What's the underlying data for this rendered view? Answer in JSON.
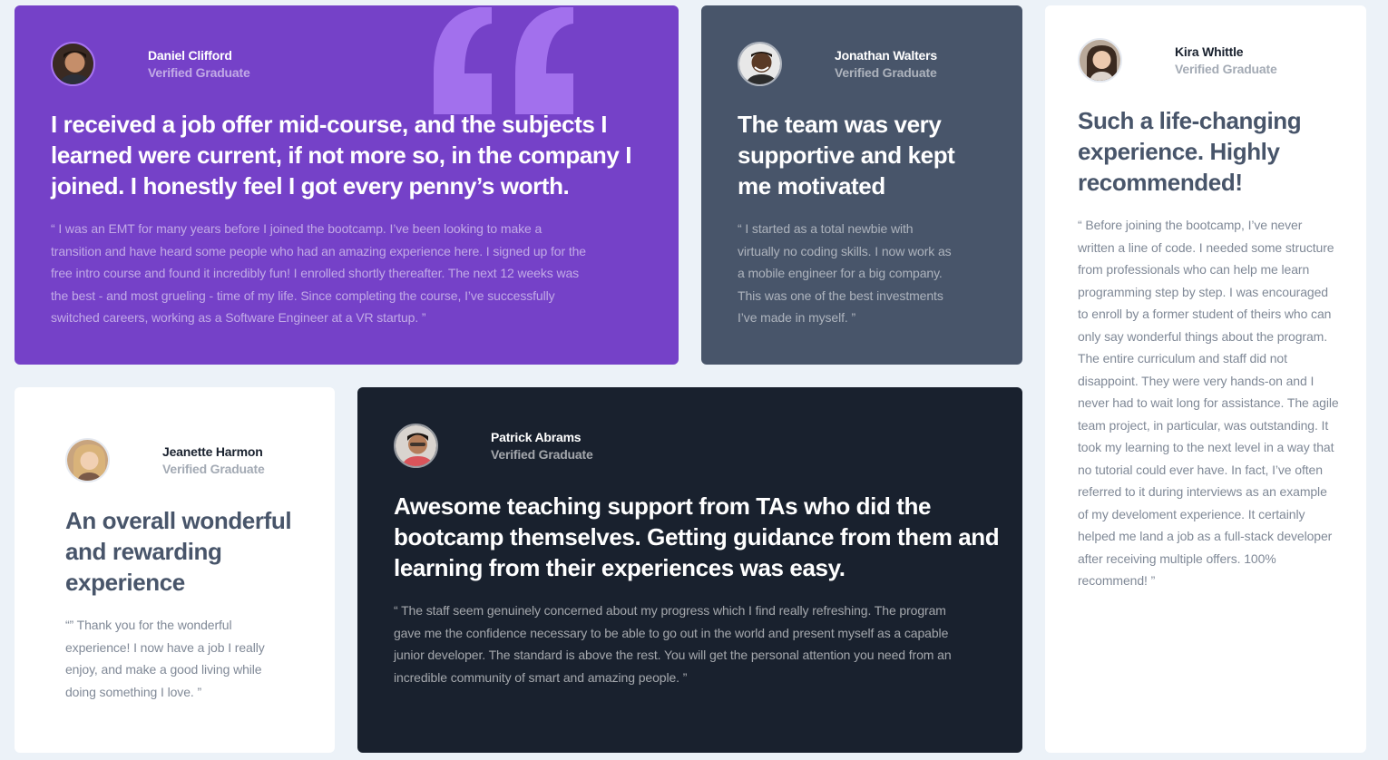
{
  "colors": {
    "page_bg": "#ecf2f8",
    "purple": "#7541c8",
    "grey_blue": "#48556a",
    "white": "#ffffff",
    "navy": "#19212e",
    "quote_mark": "#a775f1"
  },
  "testimonials": [
    {
      "name": "Daniel Clifford",
      "role": "Verified Graduate",
      "headline": "I received a job offer mid-course, and the subjects I learned were current, if not more so, in the company I joined. I honestly feel I got every penny’s worth.",
      "body": "“ I was an EMT for many years before I joined the bootcamp. I’ve been looking to make a transition and have heard some people who had an amazing experience here. I signed up for the free intro course and found it incredibly fun! I enrolled shortly thereafter. The next 12 weeks was the best - and most grueling - time of my life. Since completing the course, I’ve successfully switched careers, working as a Software Engineer at a VR startup. ”"
    },
    {
      "name": "Jonathan Walters",
      "role": "Verified Graduate",
      "headline": "The team was very supportive and kept me motivated",
      "body": "“ I started as a total newbie with virtually no coding skills. I now work as a mobile engineer for a big company. This was one of the best investments I’ve made in myself. ”"
    },
    {
      "name": "Kira Whittle",
      "role": "Verified Graduate",
      "headline": "Such a life-changing experience. Highly recommended!",
      "body": "“ Before joining the bootcamp, I’ve never written a line of code. I needed some structure from professionals who can help me learn programming step by step. I was encouraged to enroll by a former student of theirs who can only say wonderful things about the program. The entire curriculum and staff did not disappoint. They were very hands-on and I never had to wait long for assistance. The agile team project, in particular, was outstanding. It took my learning to the next level in a way that no tutorial could ever have. In fact, I’ve often referred to it during interviews as an example of my develoment experience. It certainly helped me land a job as a full-stack developer after receiving multiple offers. 100% recommend! ”"
    },
    {
      "name": "Jeanette Harmon",
      "role": "Verified Graduate",
      "headline": "An overall wonderful and rewarding experience",
      "body": "“” Thank you for the wonderful experience! I now have a job I really enjoy, and make a good living while doing something I love. ”"
    },
    {
      "name": "Patrick Abrams",
      "role": "Verified Graduate",
      "headline": "Awesome teaching support from TAs who did the bootcamp themselves. Getting guidance from them and learning from their experiences was easy.",
      "body": "“ The staff seem genuinely concerned about my progress which I find really refreshing. The program gave me the confidence necessary to be able to go out in the world and present myself as a capable junior developer. The standard is above the rest. You will get the personal attention you need from an incredible community of smart and amazing people. ”"
    }
  ]
}
